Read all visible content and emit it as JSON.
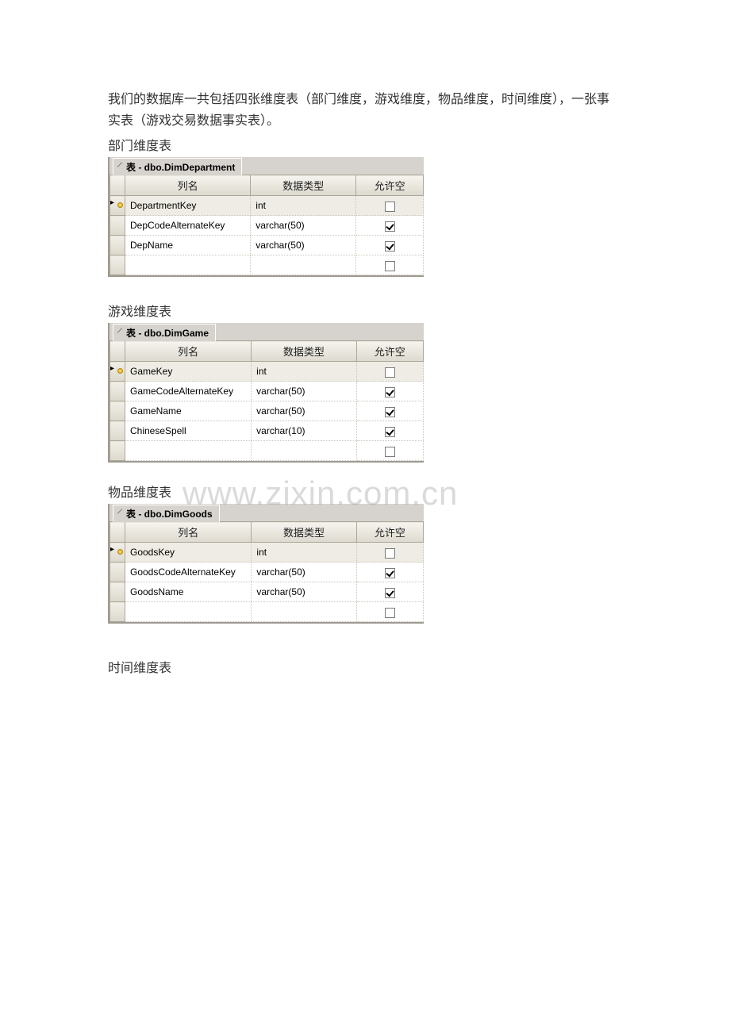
{
  "intro": {
    "line1": "我们的数据库一共包括四张维度表（部门维度，游戏维度，物品维度，时间维度），一张事",
    "line2": "实表（游戏交易数据事实表）。"
  },
  "labels": {
    "dept": "部门维度表",
    "game": "游戏维度表",
    "goods": "物品维度表",
    "time": "时间维度表"
  },
  "headers": {
    "colname": "列名",
    "datatype": "数据类型",
    "allownull": "允许空"
  },
  "tabs": {
    "dept": "表 - dbo.DimDepartment",
    "game": "表 - dbo.DimGame",
    "goods": "表 - dbo.DimGoods"
  },
  "tables": {
    "dept": [
      {
        "name": "DepartmentKey",
        "type": "int",
        "null": false,
        "pk": true
      },
      {
        "name": "DepCodeAlternateKey",
        "type": "varchar(50)",
        "null": true,
        "pk": false
      },
      {
        "name": "DepName",
        "type": "varchar(50)",
        "null": true,
        "pk": false
      }
    ],
    "game": [
      {
        "name": "GameKey",
        "type": "int",
        "null": false,
        "pk": true
      },
      {
        "name": "GameCodeAlternateKey",
        "type": "varchar(50)",
        "null": true,
        "pk": false
      },
      {
        "name": "GameName",
        "type": "varchar(50)",
        "null": true,
        "pk": false
      },
      {
        "name": "ChineseSpell",
        "type": "varchar(10)",
        "null": true,
        "pk": false
      }
    ],
    "goods": [
      {
        "name": "GoodsKey",
        "type": "int",
        "null": false,
        "pk": true
      },
      {
        "name": "GoodsCodeAlternateKey",
        "type": "varchar(50)",
        "null": true,
        "pk": false
      },
      {
        "name": "GoodsName",
        "type": "varchar(50)",
        "null": true,
        "pk": false
      }
    ]
  },
  "watermark": "www.zixin.com.cn"
}
